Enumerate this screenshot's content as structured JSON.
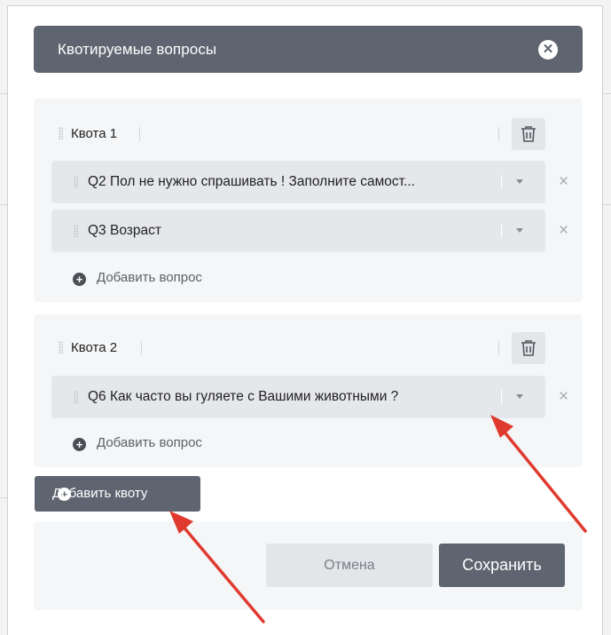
{
  "modal": {
    "title": "Квотируемые вопросы",
    "close_icon": "close-icon"
  },
  "quotas": [
    {
      "label": "Квота 1",
      "questions": [
        "Q2 Пол не нужно спрашивать ! Заполните самост...",
        "Q3 Возраст"
      ],
      "add_question_label": "Добавить вопрос"
    },
    {
      "label": "Квота 2",
      "questions": [
        "Q6 Как часто вы гуляете с Вашими животными ?"
      ],
      "add_question_label": "Добавить вопрос"
    }
  ],
  "add_quota_label": "Добавить квоту",
  "footer": {
    "cancel_label": "Отмена",
    "save_label": "Сохранить"
  },
  "colors": {
    "header_bg": "#5f6570",
    "card_bg": "#f5f6f8",
    "question_bg": "#e5e7ea",
    "annotation_arrow": "#e03a2f"
  }
}
